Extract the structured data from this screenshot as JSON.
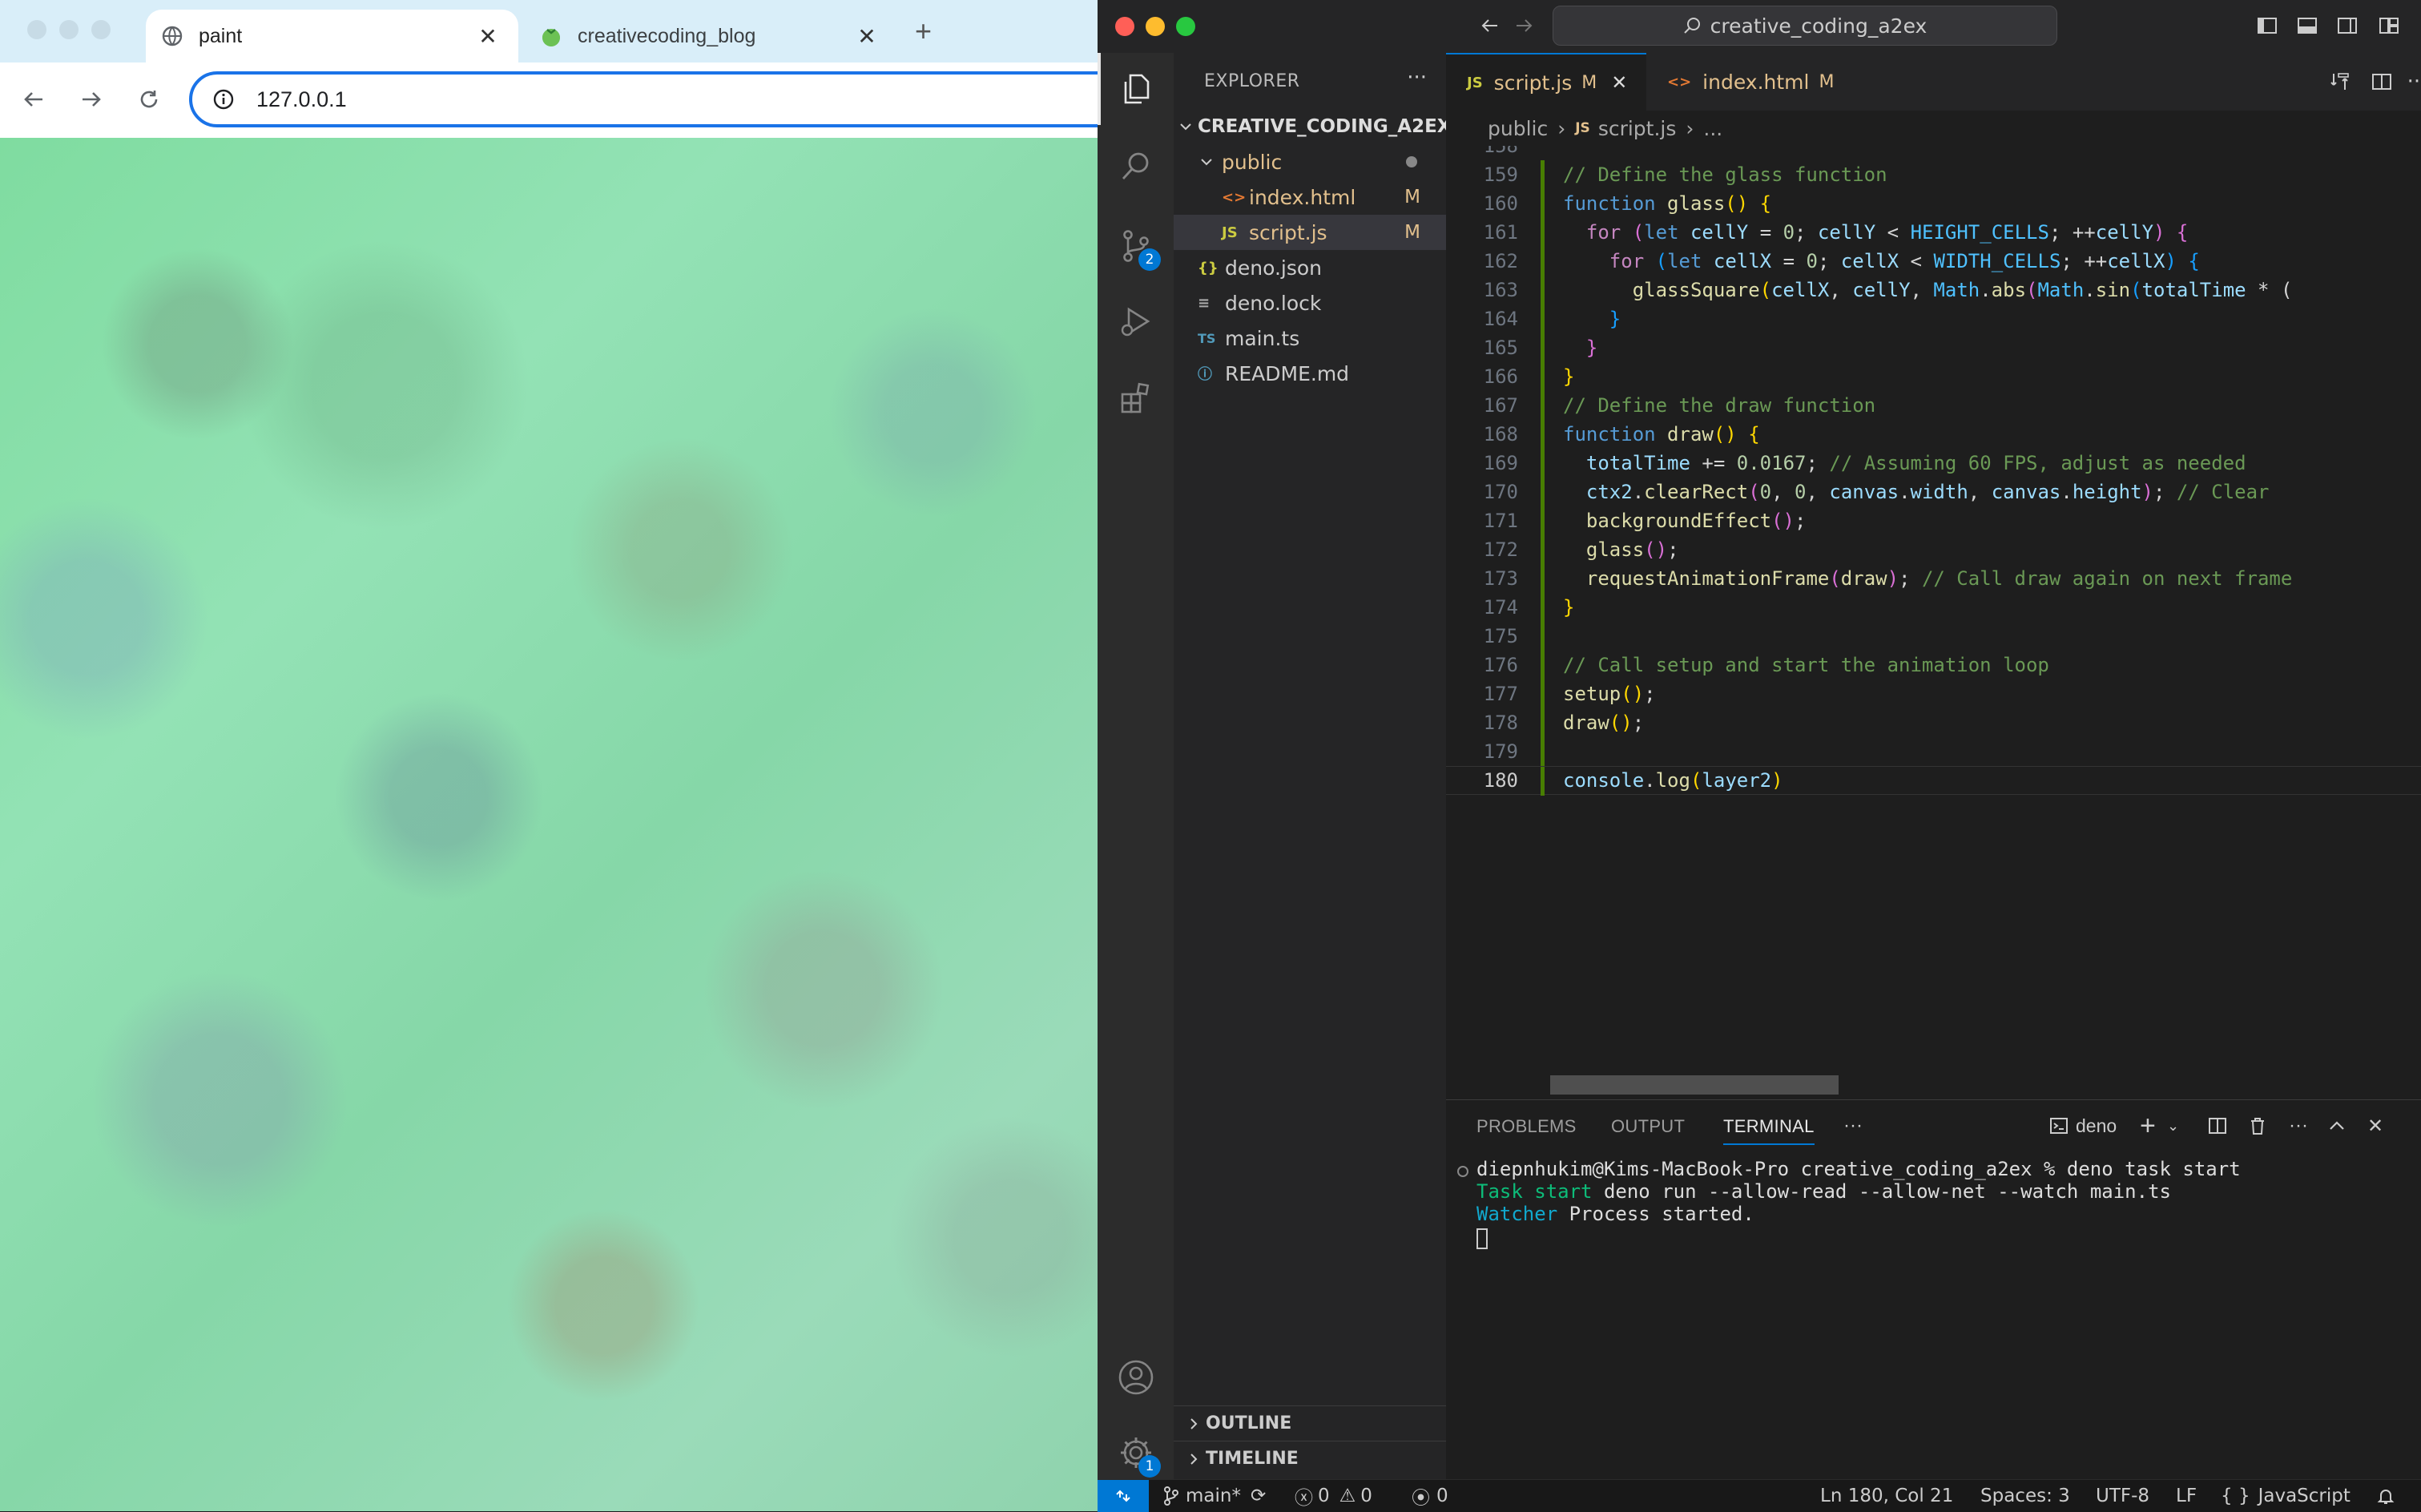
{
  "browser": {
    "tabs": [
      {
        "title": "paint",
        "active": true
      },
      {
        "title": "creativecoding_blog",
        "active": false
      }
    ],
    "url": "127.0.0.1"
  },
  "vscode": {
    "command_center": "creative_coding_a2ex",
    "explorer": {
      "header": "EXPLORER",
      "root": "CREATIVE_CODING_A2EX",
      "items": [
        {
          "name": "public",
          "type": "folder"
        },
        {
          "name": "index.html",
          "type": "html",
          "status": "M"
        },
        {
          "name": "script.js",
          "type": "js",
          "status": "M"
        },
        {
          "name": "deno.json",
          "type": "json"
        },
        {
          "name": "deno.lock",
          "type": "file"
        },
        {
          "name": "main.ts",
          "type": "ts"
        },
        {
          "name": "README.md",
          "type": "md"
        }
      ],
      "sections": [
        "OUTLINE",
        "TIMELINE"
      ]
    },
    "activity_badges": {
      "source_control": "2",
      "settings": "1"
    },
    "editor_tabs": [
      {
        "label": "script.js",
        "status": "M",
        "icon": "JS"
      },
      {
        "label": "index.html",
        "status": "M",
        "icon": "<>"
      }
    ],
    "breadcrumbs": [
      "public",
      "script.js",
      "..."
    ],
    "current_line": 180,
    "code_lines": [
      {
        "n": 158,
        "html": ""
      },
      {
        "n": 159,
        "html": "<span class='c-com'>// Define the glass function</span>"
      },
      {
        "n": 160,
        "html": "<span class='c-kw'>function</span> <span class='c-fn'>glass</span><span class='c-br1'>()</span> <span class='c-br1'>{</span>"
      },
      {
        "n": 161,
        "html": "  <span class='c-ctl'>for</span> <span class='c-br2'>(</span><span class='c-kw'>let</span> <span class='c-var'>cellY</span> <span class='c-pun'>=</span> <span class='c-num'>0</span><span class='c-pun'>;</span> <span class='c-var'>cellY</span> <span class='c-pun'>&lt;</span> <span class='c-const'>HEIGHT_CELLS</span><span class='c-pun'>;</span> <span class='c-pun'>++</span><span class='c-var'>cellY</span><span class='c-br2'>)</span> <span class='c-br2'>{</span>"
      },
      {
        "n": 162,
        "html": "    <span class='c-ctl'>for</span> <span class='c-br3'>(</span><span class='c-kw'>let</span> <span class='c-var'>cellX</span> <span class='c-pun'>=</span> <span class='c-num'>0</span><span class='c-pun'>;</span> <span class='c-var'>cellX</span> <span class='c-pun'>&lt;</span> <span class='c-const'>WIDTH_CELLS</span><span class='c-pun'>;</span> <span class='c-pun'>++</span><span class='c-var'>cellX</span><span class='c-br3'>)</span> <span class='c-br3'>{</span>"
      },
      {
        "n": 163,
        "html": "      <span class='c-fn'>glassSquare</span><span class='c-br1'>(</span><span class='c-var'>cellX</span><span class='c-pun'>,</span> <span class='c-var'>cellY</span><span class='c-pun'>,</span> <span class='c-const'>Math</span><span class='c-pun'>.</span><span class='c-fn'>abs</span><span class='c-br2'>(</span><span class='c-const'>Math</span><span class='c-pun'>.</span><span class='c-fn'>sin</span><span class='c-br3'>(</span><span class='c-var'>totalTime</span> <span class='c-pun'>*</span> <span class='c-pun'>(</span>"
      },
      {
        "n": 164,
        "html": "    <span class='c-br3'>}</span>"
      },
      {
        "n": 165,
        "html": "  <span class='c-br2'>}</span>"
      },
      {
        "n": 166,
        "html": "<span class='c-br1'>}</span>"
      },
      {
        "n": 167,
        "html": "<span class='c-com'>// Define the draw function</span>"
      },
      {
        "n": 168,
        "html": "<span class='c-kw'>function</span> <span class='c-fn'>draw</span><span class='c-br1'>()</span> <span class='c-br1'>{</span>"
      },
      {
        "n": 169,
        "html": "  <span class='c-var'>totalTime</span> <span class='c-pun'>+=</span> <span class='c-num'>0.0167</span><span class='c-pun'>;</span> <span class='c-com'>// Assuming 60 FPS, adjust as needed</span>"
      },
      {
        "n": 170,
        "html": "  <span class='c-var'>ctx2</span><span class='c-pun'>.</span><span class='c-fn'>clearRect</span><span class='c-br2'>(</span><span class='c-num'>0</span><span class='c-pun'>,</span> <span class='c-num'>0</span><span class='c-pun'>,</span> <span class='c-var'>canvas</span><span class='c-pun'>.</span><span class='c-var'>width</span><span class='c-pun'>,</span> <span class='c-var'>canvas</span><span class='c-pun'>.</span><span class='c-var'>height</span><span class='c-br2'>)</span><span class='c-pun'>;</span> <span class='c-com'>// Clear</span>"
      },
      {
        "n": 171,
        "html": "  <span class='c-fn'>backgroundEffect</span><span class='c-br2'>()</span><span class='c-pun'>;</span>"
      },
      {
        "n": 172,
        "html": "  <span class='c-fn'>glass</span><span class='c-br2'>()</span><span class='c-pun'>;</span>"
      },
      {
        "n": 173,
        "html": "  <span class='c-fn'>requestAnimationFrame</span><span class='c-br2'>(</span><span class='c-fn'>draw</span><span class='c-br2'>)</span><span class='c-pun'>;</span> <span class='c-com'>// Call draw again on next frame</span>"
      },
      {
        "n": 174,
        "html": "<span class='c-br1'>}</span>"
      },
      {
        "n": 175,
        "html": ""
      },
      {
        "n": 176,
        "html": "<span class='c-com'>// Call setup and start the animation loop</span>"
      },
      {
        "n": 177,
        "html": "<span class='c-fn'>setup</span><span class='c-br1'>()</span><span class='c-pun'>;</span>"
      },
      {
        "n": 178,
        "html": "<span class='c-fn'>draw</span><span class='c-br1'>()</span><span class='c-pun'>;</span>"
      },
      {
        "n": 179,
        "html": ""
      },
      {
        "n": 180,
        "html": "<span class='c-var'>console</span><span class='c-pun'>.</span><span class='c-fn'>log</span><span class='c-br1'>(</span><span class='c-var'>layer2</span><span class='c-br1'>)</span>"
      }
    ],
    "panel": {
      "tabs": [
        "PROBLEMS",
        "OUTPUT",
        "TERMINAL"
      ],
      "active_tab": "TERMINAL",
      "terminal_name": "deno",
      "terminal_lines": [
        "diepnhukim@Kims-MacBook-Pro creative_coding_a2ex % deno task start",
        "Task start deno run --allow-read --allow-net --watch main.ts",
        "Watcher Process started."
      ]
    },
    "status": {
      "branch": "main*",
      "errors": "0",
      "warnings": "0",
      "ports": "0",
      "position": "Ln 180, Col 21",
      "spaces": "Spaces: 3",
      "encoding": "UTF-8",
      "eol": "LF",
      "language_braces": "{ }",
      "language": "JavaScript"
    }
  },
  "colors": {
    "accent": "#0078d4",
    "modified": "#e2c08d",
    "browser_focus": "#1a73e8"
  }
}
